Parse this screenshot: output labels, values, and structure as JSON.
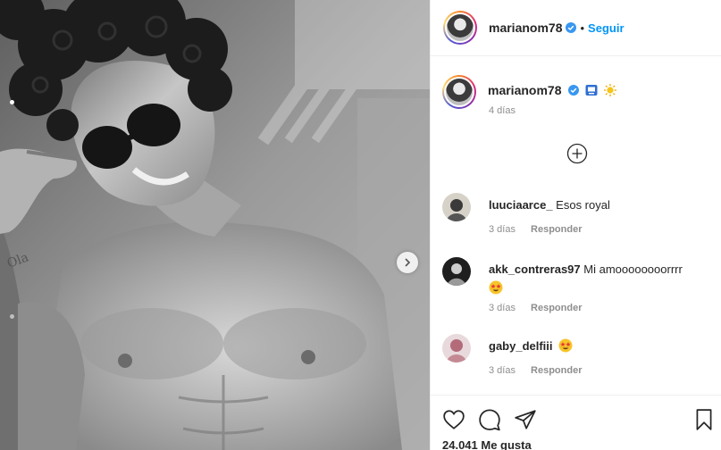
{
  "post": {
    "username": "marianom78",
    "separator": "•",
    "follow_label": "Seguir",
    "caption_time": "4 días",
    "likes_text": "24.041 Me gusta"
  },
  "comments": [
    {
      "user": "luuciaarce_",
      "text": "Esos royal",
      "time": "3 días",
      "reply": "Responder"
    },
    {
      "user": "akk_contreras97",
      "text": "Mi amoooooooorrrr",
      "time": "3 días",
      "reply": "Responder"
    },
    {
      "user": "gaby_delfiii",
      "text": "",
      "time": "3 días",
      "reply": "Responder"
    }
  ],
  "icons": {
    "verified": "verified-badge-icon",
    "load_more": "plus-circle-icon",
    "like": "heart-icon",
    "comment": "comment-bubble-icon",
    "share": "paper-plane-icon",
    "save": "bookmark-icon",
    "next": "chevron-right-icon",
    "caption_emojis": [
      "tv-icon",
      "sun-icon"
    ],
    "comment_emoji": "star-struck-emoji-icon"
  },
  "colors": {
    "accent": "#0095f6",
    "text": "#262626",
    "muted": "#8e8e8e",
    "border": "#efefef"
  }
}
